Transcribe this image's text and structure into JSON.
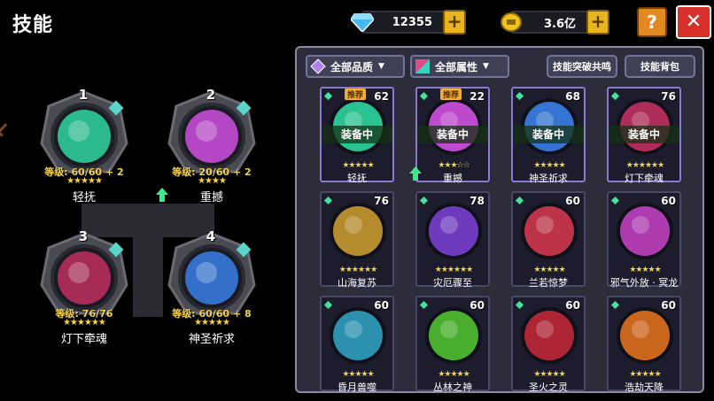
{
  "header": {
    "title": "技能"
  },
  "currency": {
    "gems": {
      "value": "12355",
      "icon": "diamond-icon"
    },
    "gold": {
      "value": "3.6亿",
      "icon": "gold-coin-icon"
    }
  },
  "buttons": {
    "help": "?",
    "close": "✕"
  },
  "slots": [
    {
      "num": "1",
      "level": "等级: 60/60 + 2",
      "stars": "★★★★★",
      "name": "轻抚",
      "color": "#2fd6a0"
    },
    {
      "num": "2",
      "level": "等级: 20/60 + 2",
      "stars": "★★★★",
      "name": "重撼",
      "color": "#d050e0"
    },
    {
      "num": "3",
      "level": "等级: 76/76",
      "stars": "★★★★★★",
      "name": "灯下牵魂",
      "color": "#c03060"
    },
    {
      "num": "4",
      "level": "等级: 60/60 + 8",
      "stars": "★★★★★",
      "name": "神圣祈求",
      "color": "#3a80e8"
    }
  ],
  "filters": {
    "quality": "全部品质",
    "attribute": "全部属性",
    "resonance": "技能突破共鸣",
    "bag": "技能背包"
  },
  "cards": [
    {
      "name": "轻抚",
      "level": "62",
      "badge": "推荐",
      "equipped": "装备中",
      "stars": "★★★★★",
      "color": "#2fd6a0"
    },
    {
      "name": "重撼",
      "level": "22",
      "badge": "推荐",
      "equipped": "装备中",
      "stars": "★★★☆☆",
      "color": "#d050e0"
    },
    {
      "name": "神圣祈求",
      "level": "68",
      "badge": "",
      "equipped": "装备中",
      "stars": "★★★★★",
      "color": "#3a80e8"
    },
    {
      "name": "灯下牵魂",
      "level": "76",
      "badge": "",
      "equipped": "装备中",
      "stars": "★★★★★★",
      "color": "#c03060"
    },
    {
      "name": "山海复苏",
      "level": "76",
      "badge": "",
      "equipped": "",
      "stars": "★★★★★★",
      "color": "#c89a30"
    },
    {
      "name": "灾厄骤至",
      "level": "78",
      "badge": "",
      "equipped": "",
      "stars": "★★★★★★",
      "color": "#7a40d0"
    },
    {
      "name": "兰若惊梦",
      "level": "60",
      "badge": "",
      "equipped": "",
      "stars": "★★★★★",
      "color": "#d03850"
    },
    {
      "name": "邪气外放 · 冥龙",
      "level": "60",
      "badge": "",
      "equipped": "",
      "stars": "★★★★★",
      "color": "#c040c0"
    },
    {
      "name": "昏月兽噬",
      "level": "60",
      "badge": "",
      "equipped": "",
      "stars": "★★★★★",
      "color": "#30a0c0"
    },
    {
      "name": "丛林之神",
      "level": "60",
      "badge": "",
      "equipped": "",
      "stars": "★★★★★",
      "color": "#50c030"
    },
    {
      "name": "圣火之灵",
      "level": "60",
      "badge": "",
      "equipped": "",
      "stars": "★★★★★",
      "color": "#c02838"
    },
    {
      "name": "浩劫天降",
      "level": "60",
      "badge": "",
      "equipped": "",
      "stars": "★★★★★",
      "color": "#e07020"
    }
  ]
}
